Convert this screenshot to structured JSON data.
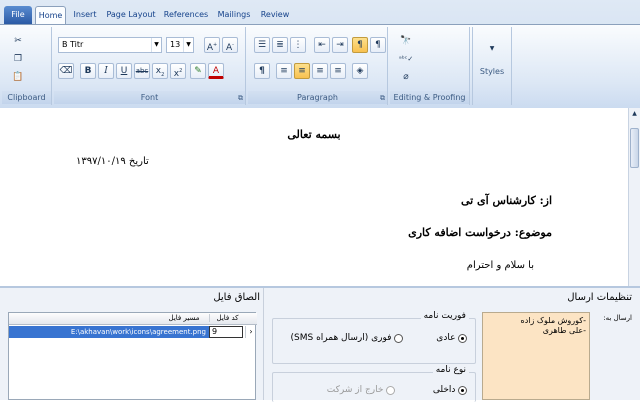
{
  "tabs": [
    "File",
    "Home",
    "Insert",
    "Page Layout",
    "References",
    "Mailings",
    "Review"
  ],
  "groups": {
    "clipboard": "Clipboard",
    "font": "Font",
    "paragraph": "Paragraph",
    "editing": "Editing & Proofing",
    "styles": "Styles"
  },
  "font": {
    "name": "B Titr",
    "size": "13"
  },
  "document": {
    "title": "بسمه تعالی",
    "date": "تاریخ ۱۳۹۷/۱۰/۱۹",
    "from": "از: کارشناس آی تی",
    "subject": "موضوع: درخواست اضافه کاری",
    "greeting": "با سلام و احترام"
  },
  "attach": {
    "title": "الصاق فایل",
    "col_code": "کد فایل",
    "col_path": "مسیر فایل",
    "row_code": "9",
    "row_path": "E:\\akhavan\\work\\icons\\agreement.png"
  },
  "send": {
    "title": "تنظیمات ارسال",
    "to_label": "ارسال به:",
    "recipients": "-کوروش ملوک زاده\n-علی طاهری",
    "urgency_title": "فوریت نامه",
    "urgency_normal": "عادی",
    "urgency_sms": "فوری (ارسال همراه SMS)",
    "type_title": "نوع نامه",
    "type_internal": "داخلی",
    "type_external": "خارج از شرکت"
  }
}
